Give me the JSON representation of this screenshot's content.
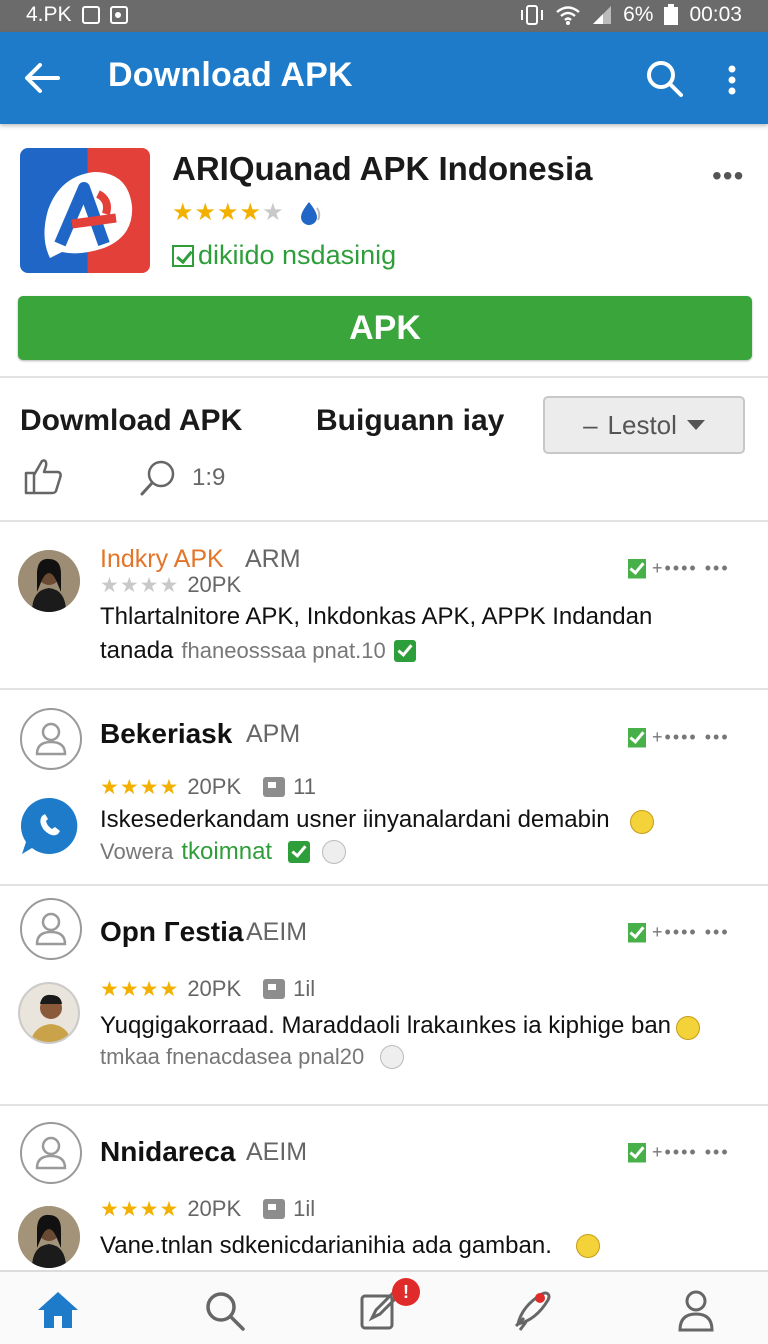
{
  "status_bar": {
    "carrier": "4.PK",
    "battery": "6%",
    "time": "00:03"
  },
  "app_bar": {
    "title": "Download APK"
  },
  "app": {
    "name": "ARIQuanad APK Indonesia",
    "rating_fraction": 0.8,
    "verified_label": "dikiido nsdasinig",
    "apk_button": "APK"
  },
  "section": {
    "left_label": "Dowmload APK",
    "mid_label": "Buiguann iay",
    "dropdown_value": "Lestol",
    "comment_count": "1:9"
  },
  "reviews": [
    {
      "name": "Indkry APK",
      "tag": "ARM",
      "meta_text": "20PK",
      "text": "Thlartalnitore APK, Inkdonkas APK, APPK Indandan",
      "sub_prefix": "tanada",
      "sub_text": "fhaneosssaa pnat.10"
    },
    {
      "name": "Bekeriask",
      "tag": "APM",
      "meta_text": "20PK",
      "meta_count": "11",
      "text": "Iskesederkandam usner iinyanalardani demabin",
      "sub_text": "Vowera",
      "sub_green": "tkoimnat"
    },
    {
      "name": "Opn Гestia",
      "tag": "AEIM",
      "meta_text": "20PK",
      "meta_count": "1il",
      "text": "Yuqgigakorraad. Maraddaoli lrakaınkes ia kiphige ban",
      "sub_text": "tmkaa fnenacdasea pnal20"
    },
    {
      "name": "Nnidareca",
      "tag": "AEIM",
      "meta_text": "20PK",
      "meta_count": "1il",
      "text": "Vane.tnlan sdkenicdarianihia ada gamban."
    }
  ],
  "bottom_nav": {
    "badge": "!"
  },
  "colors": {
    "app_bar": "#1d7bc9",
    "install_green": "#3aa53a",
    "star": "#f2b100",
    "verified_green": "#2e9e3a"
  }
}
